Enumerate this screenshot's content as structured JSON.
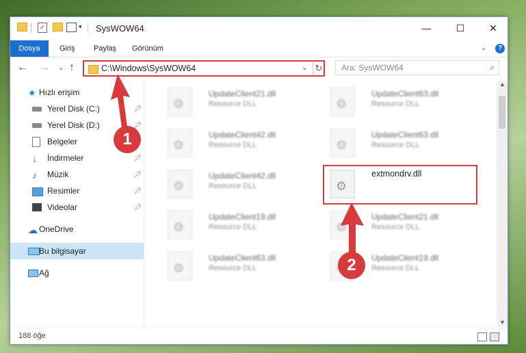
{
  "window": {
    "title": "SysWOW64",
    "controls": {
      "minimize": "—",
      "maximize": "☐",
      "close": "✕"
    }
  },
  "ribbon": {
    "tabs": [
      "Dosya",
      "Giriş",
      "Paylaş",
      "Görünüm"
    ],
    "help": "?"
  },
  "address": {
    "path": "C:\\Windows\\SysWOW64",
    "search_placeholder": "Ara: SysWOW64"
  },
  "sidebar": {
    "items": [
      {
        "label": "Hızlı erişim",
        "icon": "star-icon",
        "pinned": false
      },
      {
        "label": "Yerel Disk (C:)",
        "icon": "drive-icon",
        "pinned": true
      },
      {
        "label": "Yerel Disk (D:)",
        "icon": "drive-icon",
        "pinned": true
      },
      {
        "label": "Belgeler",
        "icon": "documents-icon",
        "pinned": true
      },
      {
        "label": "İndirmeler",
        "icon": "download-icon",
        "pinned": true
      },
      {
        "label": "Müzik",
        "icon": "music-icon",
        "pinned": true
      },
      {
        "label": "Resimler",
        "icon": "pictures-icon",
        "pinned": true
      },
      {
        "label": "Videolar",
        "icon": "videos-icon",
        "pinned": true
      },
      {
        "label": "OneDrive",
        "icon": "cloud-icon",
        "pinned": false
      },
      {
        "label": "Bu bilgisayar",
        "icon": "computer-icon",
        "pinned": false
      },
      {
        "label": "Ağ",
        "icon": "network-icon",
        "pinned": false
      }
    ]
  },
  "files": [
    {
      "name": "UpdateClient21.dll",
      "type": "Resource DLL"
    },
    {
      "name": "UpdateClient63.dll",
      "type": "Resource DLL"
    },
    {
      "name": "UpdateClient42.dll",
      "type": "Resource DLL"
    },
    {
      "name": "UpdateClient63.dll",
      "type": "Resource DLL"
    },
    {
      "name": "UpdateClient42.dll",
      "type": "Resource DLL"
    },
    {
      "name": "extmondrv.dll",
      "type": ""
    },
    {
      "name": "UpdateClient19.dll",
      "type": "Resource DLL"
    },
    {
      "name": "UpdateClient21.dll",
      "type": "Resource DLL"
    },
    {
      "name": "UpdateClient63.dll",
      "type": "Resource DLL"
    },
    {
      "name": "UpdateClient19.dll",
      "type": "Resource DLL"
    }
  ],
  "status": {
    "item_count": "188 öğe"
  },
  "annotations": {
    "step1": "1",
    "step2": "2",
    "color": "#d83b3b"
  }
}
